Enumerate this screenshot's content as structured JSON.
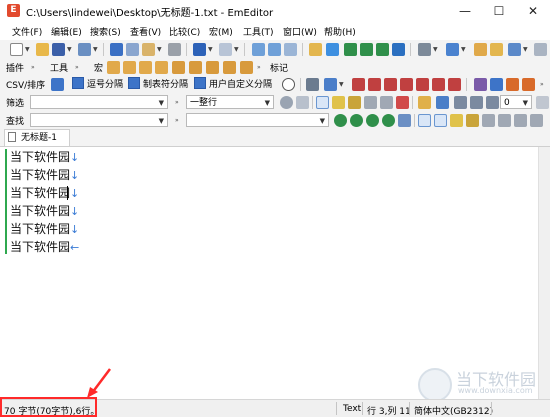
{
  "window": {
    "title": "C:\\Users\\lindewei\\Desktop\\无标题-1.txt - EmEditor",
    "minimize_glyph": "—",
    "maximize_glyph": "☐",
    "close_glyph": "✕",
    "app_icon_letter": "E"
  },
  "menu": [
    {
      "label": "文件(F)"
    },
    {
      "label": "编辑(E)"
    },
    {
      "label": "搜索(S)"
    },
    {
      "label": "查看(V)"
    },
    {
      "label": "比较(C)"
    },
    {
      "label": "宏(M)"
    },
    {
      "label": "工具(T)"
    },
    {
      "label": "窗口(W)"
    },
    {
      "label": "帮助(H)"
    }
  ],
  "toolbar_plugins": {
    "plugins_label": "插件",
    "tools_label": "工具",
    "macro_label": "宏",
    "markers_label": "标记"
  },
  "toolbar_csv": {
    "csv_label": "CSV/排序",
    "comma_label": "逗号分隔",
    "tab_label": "制表符分隔",
    "user_label": "用户自定义分隔"
  },
  "filter_bar": {
    "label": "筛选",
    "value": "",
    "line_mode": "一整行"
  },
  "find_bar": {
    "label": "查找",
    "value": "",
    "second_value": "",
    "count_value": "0"
  },
  "tab": {
    "label": "无标题-1"
  },
  "editor": {
    "lines": [
      "当下软件园",
      "当下软件园",
      "当下软件园",
      "当下软件园",
      "当下软件园",
      "当下软件园"
    ],
    "eol_mark": "↓",
    "eof_mark": "←"
  },
  "watermark": {
    "text": "当下软件园",
    "url": "www.downxia.com"
  },
  "status": {
    "summary": "70 字节(70字节),6行。",
    "mode": "Text",
    "position": "行 3,列 11",
    "encoding": "简体中文(GB2312)"
  },
  "colors": {
    "annotation": "#ff2a2a",
    "gutter": "#2fa84f",
    "eol": "#3a7bd5"
  }
}
